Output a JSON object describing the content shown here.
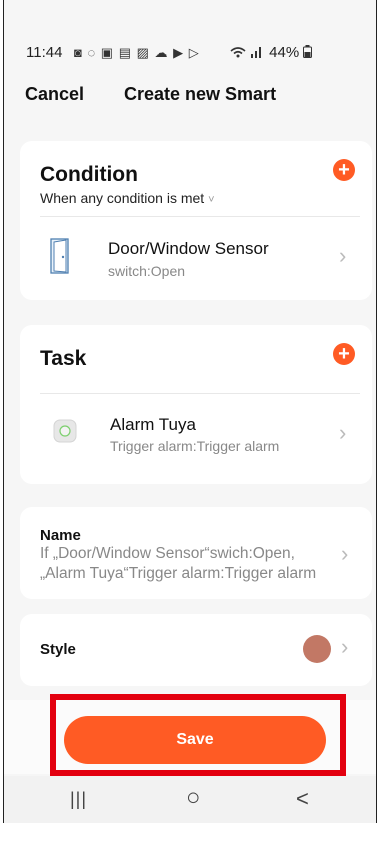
{
  "status_bar": {
    "time": "11:44",
    "notification_icons": "◙ ◌ ▣ ▤ ▨ ☁ ▶ ▷",
    "signal": "wifi-signal-bars",
    "battery": "44%"
  },
  "header": {
    "cancel_label": "Cancel",
    "title": "Create new Smart"
  },
  "condition": {
    "heading": "Condition",
    "mode": "When any condition is met",
    "mode_caret": "˅",
    "add_icon": "plus-icon",
    "item": {
      "title": "Door/Window Sensor",
      "subtitle": "switch:Open",
      "icon": "door-sensor-icon"
    }
  },
  "task": {
    "heading": "Task",
    "add_icon": "plus-icon",
    "item": {
      "title": "Alarm Tuya",
      "subtitle": "Trigger alarm:Trigger alarm",
      "icon": "alarm-device-icon"
    }
  },
  "name_card": {
    "label": "Name",
    "value_line1": "If „Door/Window Sensor“swich:Open,",
    "value_line2": "„Alarm Tuya“Trigger alarm:Trigger alarm"
  },
  "style_card": {
    "label": "Style",
    "swatch_color": "#c27865"
  },
  "save_label": "Save",
  "nav": {
    "recent": "|||",
    "home": "○",
    "back": "<"
  },
  "colors": {
    "accent": "#ff5b24",
    "highlight": "#e3000f",
    "background": "#f6f6f6"
  }
}
